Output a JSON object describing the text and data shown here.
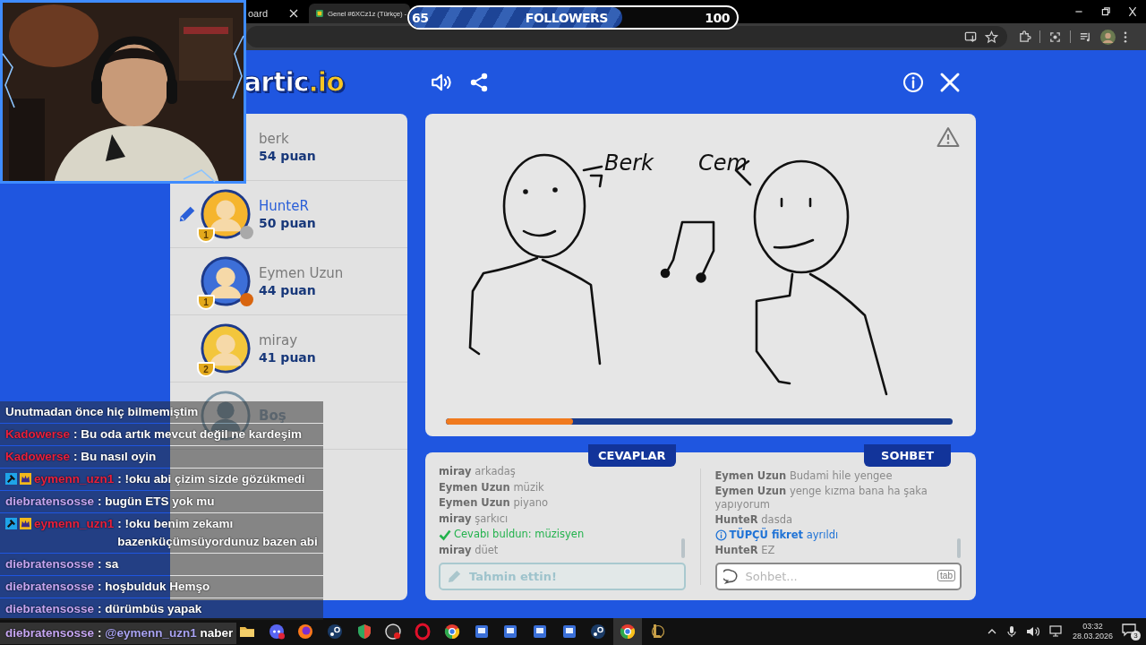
{
  "browser": {
    "tabs": [
      {
        "title": "oard",
        "selected": false
      },
      {
        "title": "Genel #6XCz1z (Türkçe) -",
        "selected": true
      }
    ]
  },
  "followers_goal": {
    "current": "65",
    "label": "FOLLOWERS",
    "target": "100",
    "level": 0.65
  },
  "game": {
    "logo": {
      "text": "artic",
      "suffix": ".io"
    },
    "players": [
      {
        "kind": "player",
        "name": "berk",
        "points": "54 puan",
        "drawing": false
      },
      {
        "kind": "player",
        "name": "HunteR",
        "points": "50 puan",
        "drawing": true,
        "avatar": {
          "color": "#f5b52e"
        },
        "trophy": "1",
        "status": {
          "color": "#a9a9a9"
        }
      },
      {
        "kind": "player",
        "name": "Eymen Uzun",
        "points": "44 puan",
        "drawing": false,
        "avatar": {
          "color": "#3d6fd8"
        },
        "trophy": "1",
        "status": {
          "color": "#d8650f"
        }
      },
      {
        "kind": "player",
        "name": "miray",
        "points": "41 puan",
        "drawing": false,
        "avatar": {
          "color": "#f3c63c"
        },
        "trophy": "2"
      },
      {
        "kind": "empty",
        "name": "Boş"
      }
    ],
    "canvas": {
      "labels": [
        "Berk",
        "Cem"
      ],
      "progress": {
        "level": 0.25
      }
    },
    "answers": {
      "title": "CEVAPLAR",
      "messages": [
        {
          "kind": "guess",
          "text": "**miray** arkadaş"
        },
        {
          "kind": "guess",
          "text": "**Eymen Uzun** müzik"
        },
        {
          "kind": "guess",
          "text": "**Eymen Uzun** piyano"
        },
        {
          "kind": "guess",
          "text": "**miray** şarkıcı"
        },
        {
          "kind": "correct",
          "text": "Cevabı buldun: **müzisyen**"
        },
        {
          "kind": "guess",
          "text": "**miray** düet"
        }
      ],
      "input": {
        "placeholder": "Tahmin ettin!",
        "disabled": true
      }
    },
    "chat": {
      "title": "SOHBET",
      "messages": [
        {
          "kind": "message",
          "text": "**Eymen Uzun** Budami hile yengee"
        },
        {
          "kind": "message",
          "text": "**Eymen Uzun** yenge kızma bana ha şaka yapıyorum"
        },
        {
          "kind": "message",
          "text": "**HunteR** dasda"
        },
        {
          "kind": "info",
          "text": "**TÜPÇÜ fikret** ayrıldı"
        },
        {
          "kind": "message",
          "text": "**HunteR** EZ"
        }
      ],
      "input": {
        "placeholder": "Sohbet...",
        "key_hint": "tab"
      }
    }
  },
  "stream_chat": {
    "messages": [
      {
        "text": "Unutmadan önce hiç bilmemiştim"
      },
      {
        "user": {
          "name": "Kadowerse",
          "color": "#e8203c"
        },
        "text": ": Bu oda artık mevcut değil ne kardeşim"
      },
      {
        "user": {
          "name": "Kadowerse",
          "color": "#e8203c"
        },
        "text": ": Bu nasıl oyin"
      },
      {
        "user": {
          "name": "eymenn_uzn1",
          "color": "#e8203c"
        },
        "badges": [
          {
            "kind": "moderator"
          },
          {
            "kind": "crown"
          }
        ],
        "text": ": !oku abi çizim sizde gözükmedi"
      },
      {
        "user": {
          "name": "diebratensosse",
          "color": "#c6a6f2"
        },
        "text": ": bugün ETS yok mu"
      },
      {
        "user": {
          "name": "eymenn_uzn1",
          "color": "#e8203c"
        },
        "badges": [
          {
            "kind": "moderator"
          },
          {
            "kind": "crown"
          }
        ],
        "text": ": !oku benim zekamı bazenküçümsüyordunuz bazen abi"
      },
      {
        "user": {
          "name": "diebratensosse",
          "color": "#c6a6f2"
        },
        "text": ": sa"
      },
      {
        "user": {
          "name": "diebratensosse",
          "color": "#c6a6f2"
        },
        "text": ": hoşbulduk Hemşo"
      },
      {
        "user": {
          "name": "diebratensosse",
          "color": "#c6a6f2"
        },
        "text": ": dürümbüs yapak"
      },
      {
        "user": {
          "name": "diebratensosse",
          "color": "#c6a6f2"
        },
        "text": ":",
        "mention": "@eymenn_uzn1",
        "text_after": "naber"
      }
    ]
  },
  "taskbar": {
    "apps": [
      {
        "kind": "folder",
        "selected": false
      },
      {
        "kind": "discord",
        "selected": false
      },
      {
        "kind": "firefox",
        "selected": false
      },
      {
        "kind": "steam",
        "selected": false
      },
      {
        "kind": "shield",
        "selected": false
      },
      {
        "kind": "recorder",
        "selected": false
      },
      {
        "kind": "opera",
        "selected": false
      },
      {
        "kind": "chrome",
        "selected": false
      },
      {
        "kind": "app",
        "selected": false
      },
      {
        "kind": "app",
        "selected": false
      },
      {
        "kind": "app",
        "selected": false
      },
      {
        "kind": "app",
        "selected": false
      },
      {
        "kind": "steam",
        "selected": false
      },
      {
        "kind": "chrome",
        "selected": true
      },
      {
        "kind": "league",
        "selected": false
      }
    ],
    "tray": {
      "time": "03:32",
      "date": "28.03.2026",
      "notifications": "3"
    }
  }
}
